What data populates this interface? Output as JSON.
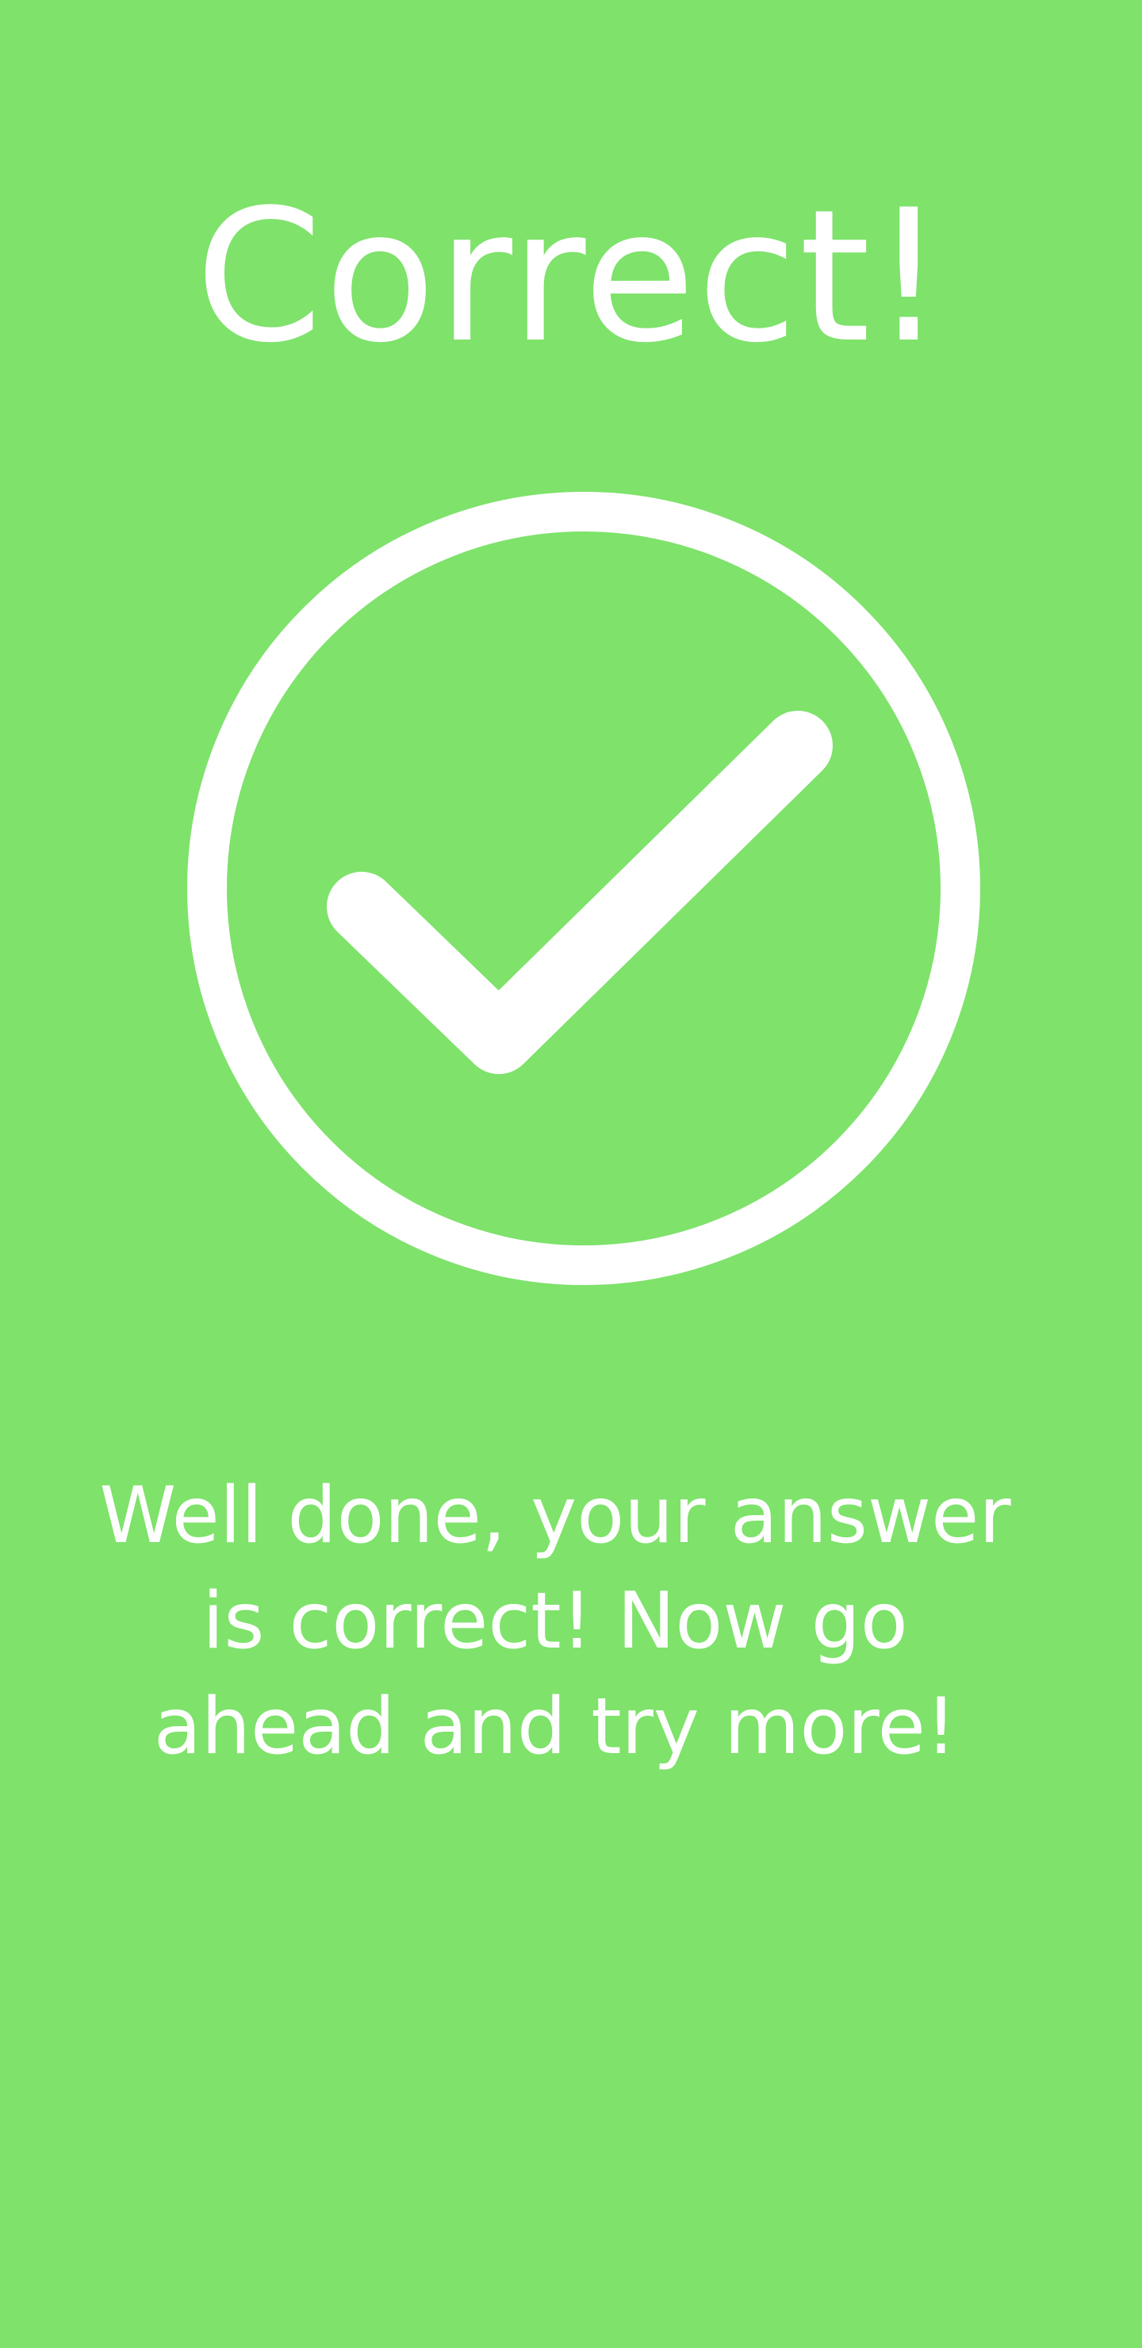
{
  "result": {
    "title": "Correct!",
    "icon": "check-circle-icon",
    "message": "Well done, your answer is correct! Now go ahead and try more!"
  },
  "colors": {
    "background": "#7ee26b",
    "foreground": "#ffffff"
  }
}
